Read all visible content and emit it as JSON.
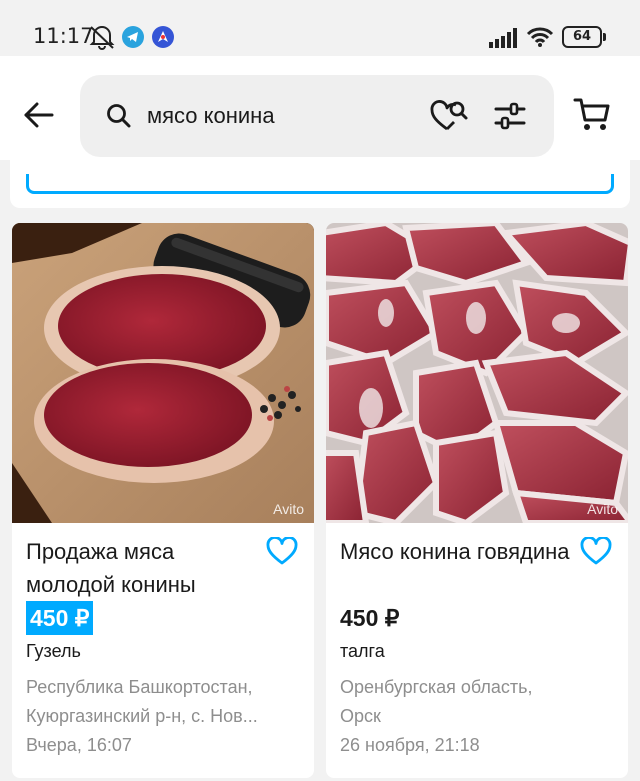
{
  "status_bar": {
    "time": "11:17",
    "battery": "64"
  },
  "search": {
    "query": "мясо конина"
  },
  "listings": [
    {
      "title": "Продажа мяса молодой конины",
      "price": "450 ₽",
      "price_highlighted": true,
      "seller": "Гузель",
      "location_line1": "Республика Башкортостан,",
      "location_line2": "Куюргазинский р-н, с. Нов...",
      "date": "Вчера, 16:07",
      "watermark": "Avito"
    },
    {
      "title": "Мясо конина говядина",
      "price": "450 ₽",
      "price_highlighted": false,
      "seller": "талга",
      "location_line1": "Оренбургская область,",
      "location_line2": "Орск",
      "date": "26 ноября, 21:18",
      "watermark": "Avito"
    }
  ],
  "colors": {
    "accent": "#00aaff",
    "favorite": "#00aaff",
    "muted_text": "#8e8e8e"
  },
  "icons": {
    "back": "arrow-left-icon",
    "search": "search-icon",
    "saved_search": "heart-search-icon",
    "filter": "filter-sliders-icon",
    "cart": "cart-icon",
    "favorite": "heart-outline-icon"
  }
}
